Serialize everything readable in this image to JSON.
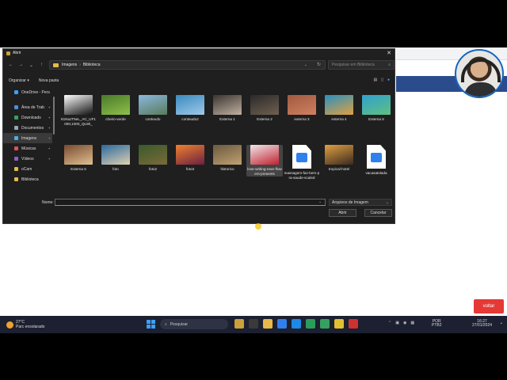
{
  "dialog": {
    "title": "Abrir",
    "close": "✕",
    "breadcrumb": [
      "Imagens",
      "Biblioteca"
    ],
    "breadcrumb_sep": "›",
    "search_placeholder": "Pesquisar em Biblioteca",
    "organize": "Organizar ▾",
    "new_folder": "Nova pasta",
    "nav_items": [
      {
        "label": "OneDrive - Pers",
        "color": "#3aa0ff"
      },
      {
        "label": "Área de Trab",
        "color": "#4a90d9"
      },
      {
        "label": "Downloads",
        "color": "#3aa060"
      },
      {
        "label": "Documentos",
        "color": "#9aa4b0"
      },
      {
        "label": "Imagens",
        "color": "#4ab0e0"
      },
      {
        "label": "Músicas",
        "color": "#e0505a"
      },
      {
        "label": "Vídeos",
        "color": "#8a60d0"
      },
      {
        "label": "oCam",
        "color": "#e6b94b"
      },
      {
        "label": "Biblioteca",
        "color": "#e6b94b"
      }
    ],
    "files": [
      {
        "name": "61NaJT5eL_AC_UF1000,1000_QL80_",
        "kind": "image",
        "colors": [
          "#ffffff",
          "#111111"
        ]
      },
      {
        "name": "cheiro-verde",
        "kind": "image",
        "colors": [
          "#4a7a2a",
          "#8fbf4a"
        ]
      },
      {
        "name": "conteudo",
        "kind": "image",
        "colors": [
          "#8ab8e0",
          "#5a7a5a"
        ]
      },
      {
        "name": "conteudo2",
        "kind": "image",
        "colors": [
          "#3a8ac0",
          "#a0c8e8"
        ]
      },
      {
        "name": "Externa 1",
        "kind": "image",
        "colors": [
          "#3a3530",
          "#c0b0a0"
        ]
      },
      {
        "name": "Externa 2",
        "kind": "image",
        "colors": [
          "#2a2a2a",
          "#706050"
        ]
      },
      {
        "name": "externa 3",
        "kind": "image",
        "colors": [
          "#a05a40",
          "#d08060"
        ]
      },
      {
        "name": "externa 4",
        "kind": "image",
        "colors": [
          "#2a90c0",
          "#e0a040"
        ]
      },
      {
        "name": "Externa 5",
        "kind": "image",
        "colors": [
          "#30a0d0",
          "#60c080"
        ]
      },
      {
        "name": "Externa 6",
        "kind": "image",
        "colors": [
          "#7a4a30",
          "#e0c090"
        ]
      },
      {
        "name": "foto",
        "kind": "image",
        "colors": [
          "#2a6aa0",
          "#e0d0b0"
        ]
      },
      {
        "name": "foto2",
        "kind": "image",
        "colors": [
          "#3a5a2a",
          "#7a6a3a"
        ]
      },
      {
        "name": "foto3",
        "kind": "image",
        "colors": [
          "#f08030",
          "#6a2040"
        ]
      },
      {
        "name": "historico",
        "kind": "image",
        "colors": [
          "#6a5a40",
          "#c0a070"
        ]
      },
      {
        "name": "love-writing-near-flowers-presents",
        "kind": "image",
        "colors": [
          "#f0e8e8",
          "#c02030"
        ]
      },
      {
        "name": "massagem-faz-bem-pra-saude-scaled",
        "kind": "doc",
        "colors": []
      },
      {
        "name": "tropical-hotel",
        "kind": "image",
        "colors": [
          "#e0a040",
          "#3a2a20"
        ]
      },
      {
        "name": "vacasatolada",
        "kind": "doc",
        "colors": []
      }
    ],
    "name_label": "Nome:",
    "name_value": "",
    "filetype": "Arquivos de Imagem",
    "open_button": "Abrir",
    "cancel_button": "Cancelar"
  },
  "page": {
    "voltar_button": "voltar"
  },
  "taskbar": {
    "weather_temp": "27°C",
    "weather_desc": "Parc ensolarado",
    "search": "Pesquisar",
    "lang_top": "POR",
    "lang_bottom": "PTB2",
    "time": "16:27",
    "date": "27/01/2024"
  }
}
